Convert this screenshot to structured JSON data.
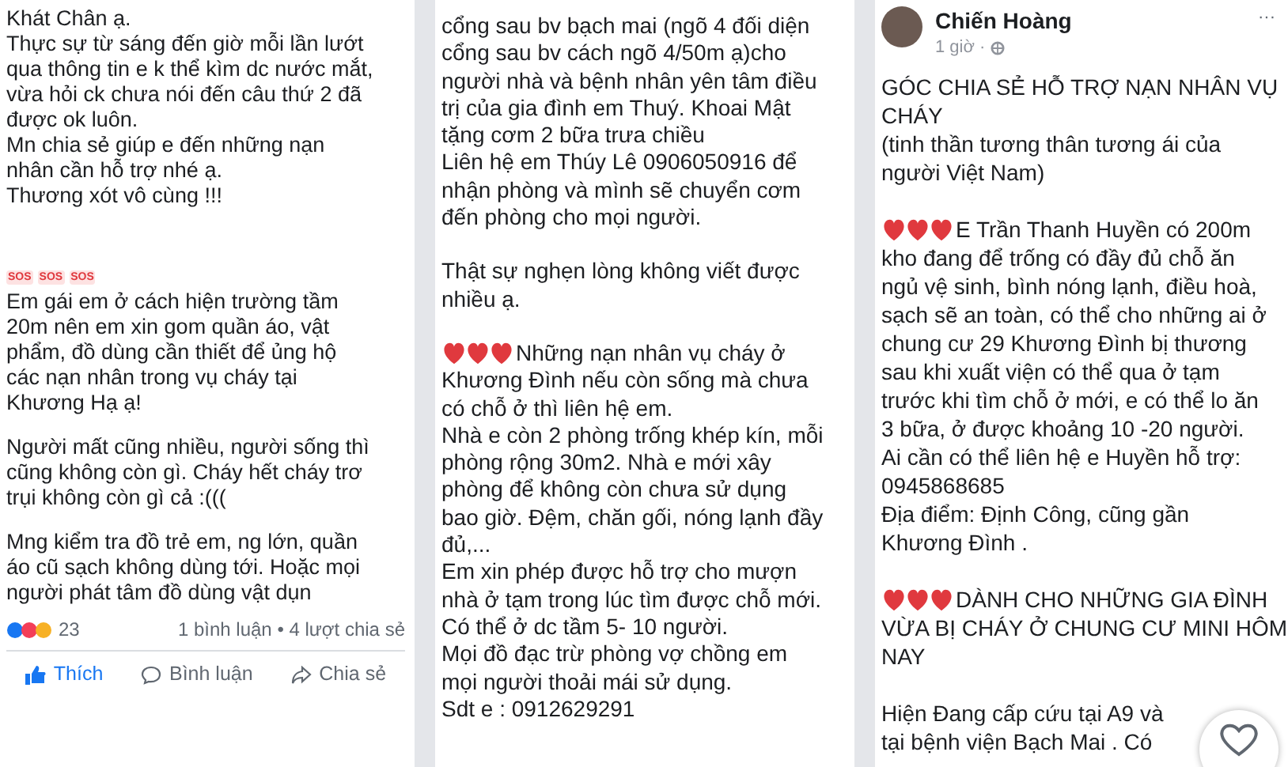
{
  "posts": [
    {
      "paragraphs": [
        {
          "kind": "text",
          "lines": [
            "Khát Chân ạ.",
            "Thực sự từ sáng đến giờ mỗi lần lướt",
            "qua thông tin e k thể kìm dc nước mắt,",
            "vừa hỏi ck chưa nói đến câu thứ 2 đã",
            "được ok luôn.",
            "Mn chia sẻ giúp e đến những nạn",
            "nhân cần hỗ trợ nhé ạ.",
            "Thương xót vô cùng !!!"
          ]
        },
        {
          "kind": "sos",
          "badges": [
            "SOS",
            "SOS",
            "SOS"
          ]
        },
        {
          "kind": "text",
          "lines": [
            "Em gái em ở cách hiện trường tầm",
            "20m nên em xin gom quần áo, vật",
            "phẩm, đồ dùng cần thiết để ủng hộ",
            "các nạn nhân trong vụ cháy tại",
            "Khương Hạ ạ!"
          ]
        },
        {
          "kind": "text",
          "lines": [
            "Người mất cũng nhiều, người sống thì",
            "cũng không còn gì. Cháy hết cháy trơ",
            "trụi không còn gì cả :((("
          ]
        },
        {
          "kind": "text",
          "lines": [
            "Mng kiểm tra đồ trẻ em, ng lớn, quần",
            "áo cũ sạch không dùng tới. Hoặc mọi",
            "người phát tâm đồ dùng vật dụn"
          ]
        }
      ],
      "reactions": {
        "count": "23",
        "summary": "1 bình luận • 4 lượt chia sẻ"
      },
      "actions": [
        {
          "label": "Thích",
          "selected": true
        },
        {
          "label": "Bình luận",
          "selected": false
        },
        {
          "label": "Chia sẻ",
          "selected": false
        }
      ]
    },
    {
      "paragraphs": [
        {
          "kind": "text",
          "lines": [
            "cổng sau bv bạch mai (ngõ 4 đối diện",
            "cổng sau bv cách ngõ 4/50m ạ)cho",
            "người nhà và bệnh nhân yên tâm điều",
            "trị của gia đình em Thuý. Khoai Mật",
            "tặng cơm 2 bữa trưa chiều",
            "Liên hệ em Thúy Lê 0906050916 để",
            "nhận phòng và mình sẽ chuyển cơm",
            "đến phòng cho mọi người."
          ]
        },
        {
          "kind": "text",
          "lines": [
            "Thật sự nghẹn lòng không viết được",
            "nhiều ạ."
          ]
        },
        {
          "kind": "hearts",
          "lines": [
            "Những nạn nhân vụ cháy ở",
            "Khương Đình nếu còn sống mà chưa",
            "có chỗ ở thì liên hệ em.",
            "Nhà e còn 2 phòng trống khép kín, mỗi",
            "phòng rộng 30m2. Nhà e mới xây",
            "phòng để không còn chưa sử dụng",
            "bao giờ. Đệm, chăn gối, nóng lạnh đầy",
            "đủ,...",
            "Em xin phép được hỗ trợ cho mượn",
            "nhà ở tạm trong lúc tìm được chỗ mới.",
            "Có thể ở dc tầm 5- 10 người.",
            "Mọi đồ đạc trừ phòng vợ chồng em",
            "mọi người thoải mái sử dụng.",
            "Sdt e : 0912629291"
          ]
        }
      ]
    },
    {
      "author": "Chiến Hoàng",
      "time": "1 giờ ·",
      "more": "···",
      "paragraphs": [
        {
          "kind": "text",
          "lines": [
            "GÓC CHIA SẺ HỖ TRỢ NẠN NHÂN VỤ",
            "CHÁY",
            "(tinh thần tương thân tương ái của",
            "người Việt Nam)"
          ]
        },
        {
          "kind": "hearts",
          "lines": [
            "E Trần Thanh Huyền có 200m",
            "kho đang để trống có đầy đủ chỗ ăn",
            "ngủ vệ sinh, bình nóng lạnh, điều hoà,",
            "sạch sẽ an toàn, có thể cho những ai ở",
            "chung cư 29 Khương Đình bị thương",
            "sau khi xuất viện có thể qua ở tạm",
            "trước khi tìm chỗ ở mới, e có thể lo ăn",
            "3 bữa, ở được khoảng 10 -20 người.",
            "Ai cần có thể liên hệ e Huyền hỗ trợ:",
            "0945868685",
            "Địa điểm: Định Công, cũng gần",
            "Khương Đình ."
          ]
        },
        {
          "kind": "hearts",
          "lines": [
            "DÀNH CHO NHỮNG GIA ĐÌNH",
            "VỪA BỊ CHÁY Ở CHUNG CƯ MINI HÔM",
            "NAY"
          ]
        },
        {
          "kind": "text",
          "lines": [
            "Hiện Đang cấp cứu tại A9 và",
            "tại bệnh viện Bạch Mai . Có"
          ]
        }
      ],
      "floating_like": true
    }
  ]
}
